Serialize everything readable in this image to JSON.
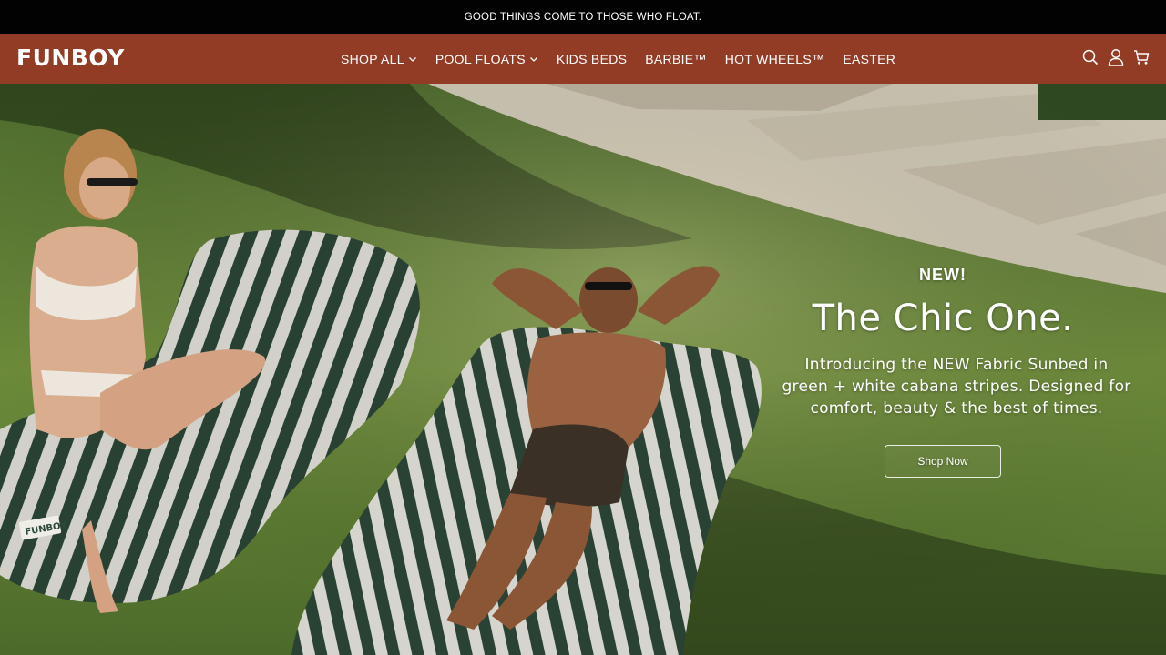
{
  "announcement": "GOOD THINGS COME TO THOSE WHO FLOAT.",
  "brand": "FUNBOY",
  "nav": [
    {
      "label": "SHOP ALL",
      "dropdown": true
    },
    {
      "label": "POOL FLOATS",
      "dropdown": true
    },
    {
      "label": "KIDS BEDS",
      "dropdown": false
    },
    {
      "label": "BARBIE™",
      "dropdown": false
    },
    {
      "label": "HOT WHEELS™",
      "dropdown": false
    },
    {
      "label": "EASTER",
      "dropdown": false
    }
  ],
  "header_icons": [
    "search-icon",
    "account-icon",
    "cart-icon"
  ],
  "hero": {
    "eyebrow": "NEW!",
    "headline": "The Chic One.",
    "subtext_lines": [
      "Introducing the NEW Fabric Sunbed in",
      "green + white cabana stripes. Designed for",
      "comfort, beauty & the best of times."
    ],
    "cta": "Shop Now",
    "bed_logo": "FUNBOY"
  },
  "colors": {
    "announcement_bg": "#020202",
    "header_bg": "#923c25",
    "text": "#ffffff",
    "stripe_green": "#2f4a3a",
    "stripe_white": "#eeeee6"
  }
}
